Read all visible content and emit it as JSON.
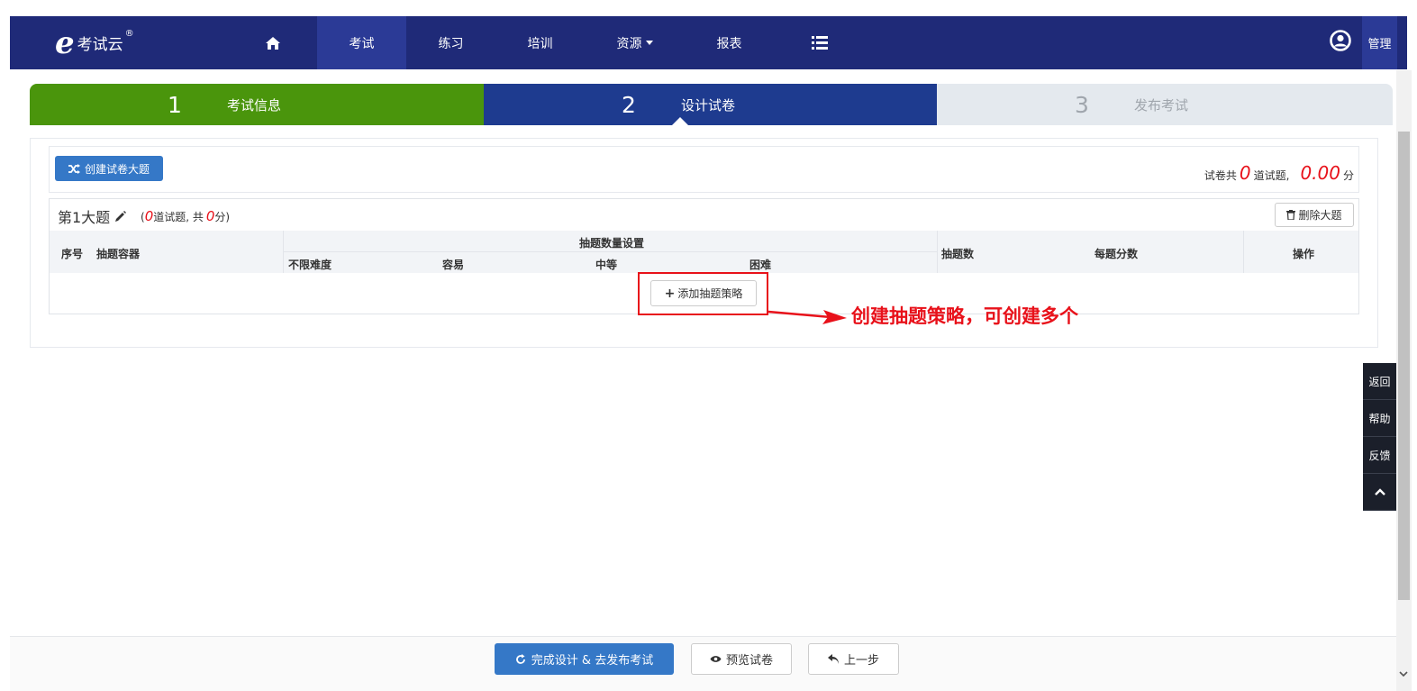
{
  "header": {
    "logo_mark": "e",
    "logo_text": "考试云",
    "logo_reg": "®",
    "nav": [
      {
        "label": "考试"
      },
      {
        "label": "练习"
      },
      {
        "label": "培训"
      },
      {
        "label": "资源"
      },
      {
        "label": "报表"
      }
    ],
    "manage": "管理"
  },
  "steps": [
    {
      "num": "1",
      "label": "考试信息"
    },
    {
      "num": "2",
      "label": "设计试卷"
    },
    {
      "num": "3",
      "label": "发布考试"
    }
  ],
  "toolbar": {
    "create_label": "创建试卷大题",
    "summary_prefix": "试卷共",
    "question_count": "0",
    "summary_mid": "道试题,",
    "total_score": "0.00",
    "summary_suffix": "分"
  },
  "section": {
    "title": "第1大题",
    "meta_open": "(",
    "meta_count": "0",
    "meta_mid": "道试题, 共",
    "meta_score": "0",
    "meta_close": "分)",
    "delete_label": "删除大题",
    "columns": {
      "index": "序号",
      "container": "抽题容器",
      "quantity_group": "抽题数量设置",
      "any_difficulty": "不限难度",
      "easy": "容易",
      "medium": "中等",
      "hard": "困难",
      "draw_count": "抽题数",
      "score_each": "每题分数",
      "actions": "操作"
    },
    "add_strategy_label": "添加抽题策略"
  },
  "annotation": "创建抽题策略，可创建多个",
  "side_tools": [
    "返回",
    "帮助",
    "反馈"
  ],
  "footer": {
    "finish_label": "完成设计 & 去发布考试",
    "preview_label": "预览试卷",
    "prev_label": "上一步"
  },
  "colors": {
    "nav_bg": "#1f2a78",
    "step_done": "#4a950c",
    "step_active": "#1e3b8f",
    "step_pending": "#e4e9ee",
    "primary": "#3578c7",
    "annotation_red": "#e8111a"
  }
}
